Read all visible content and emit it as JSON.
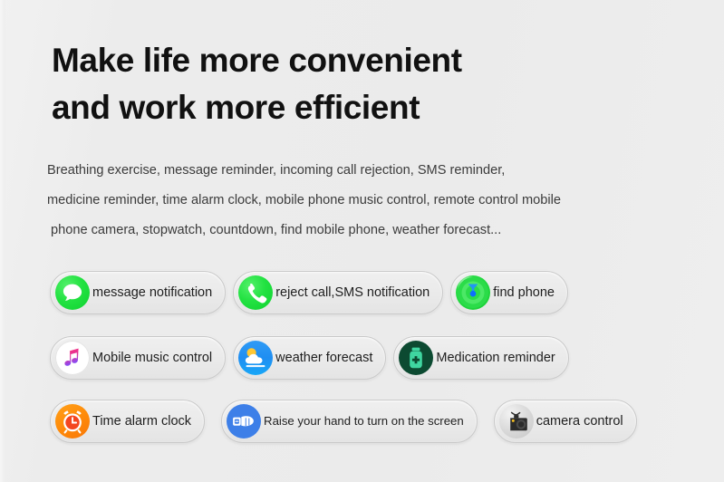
{
  "headline": {
    "line1": "Make life more convenient",
    "line2": "and work more efficient"
  },
  "description": {
    "line1": "Breathing exercise, message reminder, incoming call rejection, SMS reminder,",
    "line2": "medicine reminder, time alarm clock, mobile phone music control, remote control mobile",
    "line3": " phone camera, stopwatch, countdown, find mobile phone, weather forecast..."
  },
  "features": {
    "row1": [
      {
        "label": "message notification",
        "icon": "message-bubble-icon",
        "color": "#1ad935"
      },
      {
        "label": "reject call,SMS notification",
        "icon": "phone-handset-icon",
        "color": "#1ad935"
      },
      {
        "label": "find phone",
        "icon": "find-phone-radar-icon",
        "color": "#16cc33"
      }
    ],
    "row2": [
      {
        "label": "Mobile music control",
        "icon": "music-note-icon",
        "color": "#ffffff"
      },
      {
        "label": "weather forecast",
        "icon": "sun-cloud-icon",
        "color": "#1f8ef2"
      },
      {
        "label": "Medication reminder",
        "icon": "pill-bottle-icon",
        "color": "#0c4a31"
      }
    ],
    "row3": [
      {
        "label": "Time alarm clock",
        "icon": "alarm-clock-icon",
        "color": "#ff8c0a"
      },
      {
        "label": "Raise your hand to turn on the screen",
        "icon": "raise-hand-wrist-icon",
        "color": "#3d7fe8"
      },
      {
        "label": "camera control",
        "icon": "camera-icon",
        "color": "#c6c6c6"
      }
    ]
  },
  "background_color": "#ececec"
}
